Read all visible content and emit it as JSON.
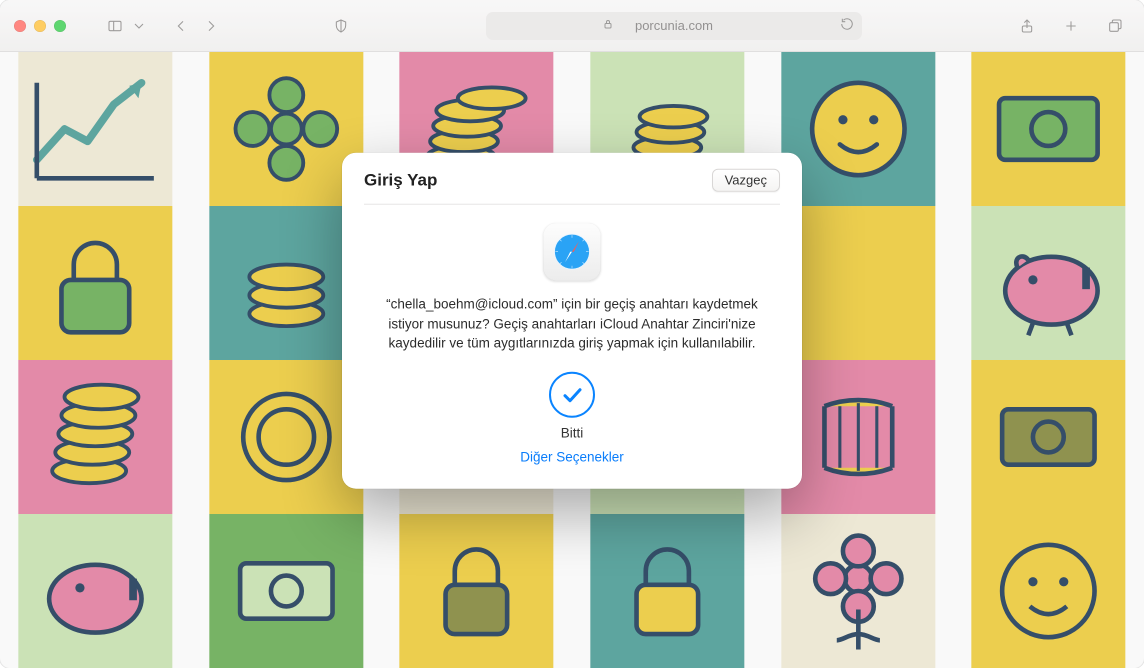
{
  "toolbar": {
    "url_display": "porcunia.com"
  },
  "dialog": {
    "title": "Giriş Yap",
    "cancel_label": "Vazgeç",
    "message": "“chella_boehm@icloud.com” için bir geçiş anahtarı kaydetmek istiyor musunuz? Geçiş anahtarları iCloud Anahtar Zinciri'nize kaydedilir ve tüm aygıtlarınızda giriş yapmak için kullanılabilir.",
    "done_label": "Bitti",
    "other_options_label": "Diğer Seçenekler"
  },
  "palette": {
    "yellow": "#f2d24a",
    "green": "#75b562",
    "teal": "#5aa6a0",
    "pink": "#e88aa9",
    "navy": "#2f4a66",
    "cream": "#f3edd9",
    "olive": "#8f924b",
    "mint": "#cfe7b8"
  }
}
